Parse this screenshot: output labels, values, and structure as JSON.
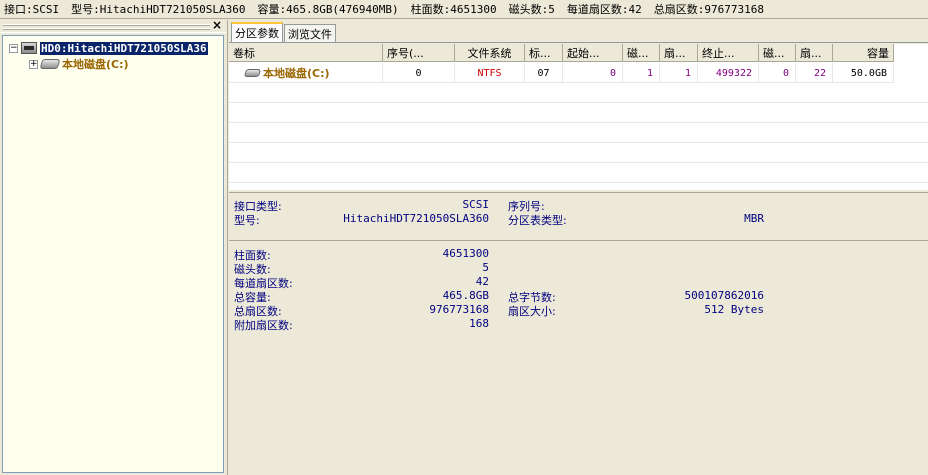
{
  "infobar": {
    "interface_label": "接口:",
    "interface_value": "SCSI",
    "model_label": "型号:",
    "model_value": "HitachiHDT721050SLA360",
    "capacity_label": "容量:",
    "capacity_value": "465.8GB(476940MB)",
    "cylinders_label": "柱面数:",
    "cylinders_value": "4651300",
    "heads_label": "磁头数:",
    "heads_value": "5",
    "sectors_per_track_label": "每道扇区数:",
    "sectors_per_track_value": "42",
    "total_sectors_label": "总扇区数:",
    "total_sectors_value": "976773168"
  },
  "tree": {
    "close_glyph": "×",
    "disk_label": "HD0:HitachiHDT721050SLA36",
    "disk_expander": "−",
    "volume_label": "本地磁盘(C:)",
    "volume_expander": "+"
  },
  "tabs": [
    {
      "label": "分区参数"
    },
    {
      "label": "浏览文件"
    }
  ],
  "grid": {
    "headers": [
      "卷标",
      "序号(...",
      "文件系统",
      "标...",
      "起始...",
      "磁...",
      "扇...",
      "终止...",
      "磁...",
      "扇...",
      "容量"
    ],
    "rows": [
      {
        "volume": "本地磁盘(C:)",
        "index": "0",
        "fs": "NTFS",
        "id": "07",
        "start_cyl": "0",
        "start_head": "1",
        "start_sector": "1",
        "end_cyl": "499322",
        "end_head": "0",
        "end_sector": "22",
        "capacity": "50.0GB"
      }
    ]
  },
  "details1": {
    "interface_type_label": "接口类型:",
    "interface_type_value": "SCSI",
    "model_label": "型号:",
    "model_value": "HitachiHDT721050SLA360",
    "serial_label": "序列号:",
    "serial_value": "",
    "partition_table_label": "分区表类型:",
    "partition_table_value": "MBR"
  },
  "details2": {
    "cylinders_label": "柱面数:",
    "cylinders_value": "4651300",
    "heads_label": "磁头数:",
    "heads_value": "5",
    "spt_label": "每道扇区数:",
    "spt_value": "42",
    "total_capacity_label": "总容量:",
    "total_capacity_value": "465.8GB",
    "total_sectors_label": "总扇区数:",
    "total_sectors_value": "976773168",
    "extra_sectors_label": "附加扇区数:",
    "extra_sectors_value": "168",
    "total_bytes_label": "总字节数:",
    "total_bytes_value": "500107862016",
    "sector_size_label": "扇区大小:",
    "sector_size_value": "512 Bytes"
  },
  "colors": {
    "selection": "#0a246a",
    "volume_text": "#996600",
    "fs_text": "#cc0000",
    "value_text": "#800080",
    "detail_text": "#000080"
  }
}
